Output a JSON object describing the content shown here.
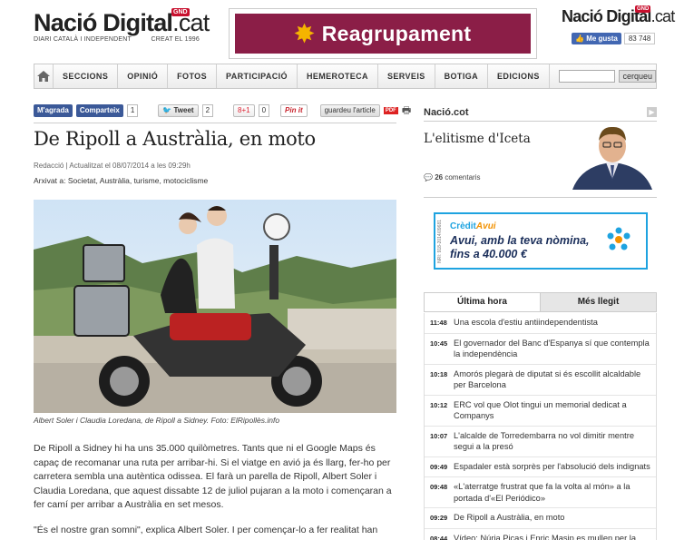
{
  "header": {
    "logo_main": "Nació Digital",
    "logo_tld": ".cat",
    "logo_badge": "GND",
    "logo_sub_left": "DIARI CATALÀ I INDEPENDENT",
    "logo_sub_right": "CREAT EL 1996",
    "banner_text": "Reagrupament",
    "right_logo_main": "Nació Digital",
    "right_logo_tld": ".cat",
    "right_logo_badge": "GND",
    "like_label": "Me gusta",
    "like_count": "83 748"
  },
  "nav": {
    "items": [
      "SECCIONS",
      "OPINIÓ",
      "FOTOS",
      "PARTICIPACIÓ",
      "HEMEROTECA",
      "SERVEIS",
      "BOTIGA",
      "EDICIONS"
    ],
    "search_value": "",
    "search_button": "cerqueu"
  },
  "share": {
    "fb_like": "M'agrada",
    "fb_share": "Comparteix",
    "fb_share_count": "1",
    "tweet": "Tweet",
    "tweet_count": "2",
    "gplus": "8+1",
    "gplus_count": "0",
    "pinit": "Pin it",
    "save": "guardeu l'article",
    "pdf": "PDF"
  },
  "article": {
    "title": "De Ripoll a Austràlia, en moto",
    "meta": "Redacció | Actualitzat el 08/07/2014 a les 09:29h",
    "archive_label": "Arxivat a:",
    "archive_tags": "Societat, Austràlia, turisme, motociclisme",
    "caption": "Albert Soler i Claudia Loredana, de Ripoll a Sidney. Foto: ElRipollès.info",
    "paragraph1": "De Ripoll a Sidney hi ha uns 35.000 quilòmetres. Tants que ni el Google Maps és capaç de recomanar una ruta per arribar-hi. Si el viatge en avió ja és llarg, fer-ho per carretera sembla una autèntica odissea. El farà un parella de Ripoll, Albert Soler i Claudia Loredana, que aquest dissabte 12 de juliol pujaran a la moto i començaran a fer camí per arribar a Austràlia en set mesos.",
    "paragraph2": "\"És el nostre gran somni\", explica Albert Soler. I per començar-lo a fer realitat han"
  },
  "sidebar": {
    "section_title": "Nació.cot",
    "article_title": "L'elitisme d'Iceta",
    "comments_count": "26",
    "comments_label": "comentaris",
    "ad_brand": "Crèdit",
    "ad_brand_accent": "Avui",
    "ad_line1": "Avui, amb la teva nòmina,",
    "ad_line2": "fins a 40.000 €",
    "ad_code": "NRI: 918-2014/09681",
    "tab_latest": "Última hora",
    "tab_most_read": "Més llegit",
    "latest": [
      {
        "time": "11:48",
        "headline": "Una escola d'estiu antiindependentista"
      },
      {
        "time": "10:45",
        "headline": "El governador del Banc d'Espanya sí que contempla la independència"
      },
      {
        "time": "10:18",
        "headline": "Amorós plegarà de diputat si és escollit alcaldable per Barcelona"
      },
      {
        "time": "10:12",
        "headline": "ERC vol que Olot tingui un memorial dedicat a Companys"
      },
      {
        "time": "10:07",
        "headline": "L'alcalde de Torredembarra no vol dimitir mentre segui a la presó"
      },
      {
        "time": "09:49",
        "headline": "Espadaler està sorprès per l'absolució dels indignats"
      },
      {
        "time": "09:48",
        "headline": "«L'aterratge frustrat que fa la volta al món» a la portada d'«El Periódico»"
      },
      {
        "time": "09:29",
        "headline": "De Ripoll a Austràlia, en moto"
      },
      {
        "time": "08:44",
        "headline": "Vídeo: Núria Picas i Enric Masip es mullen per la"
      }
    ]
  }
}
